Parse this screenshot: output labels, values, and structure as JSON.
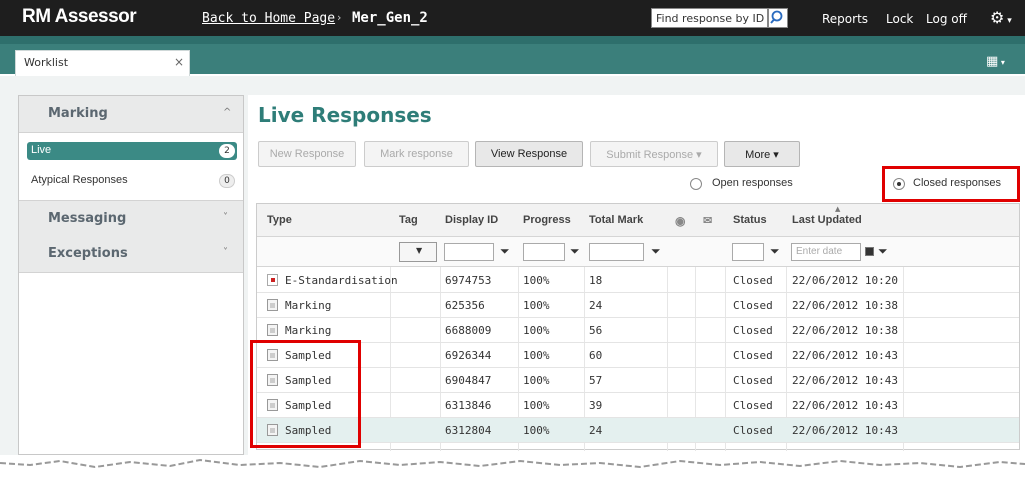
{
  "header": {
    "logo": "RM Assessor",
    "back_link": "Back to Home Page",
    "breadcrumb_sep": "›",
    "current": "Mer_Gen_2",
    "find_placeholder": "Find response by ID ▾",
    "reports": "Reports",
    "lock": "Lock",
    "logoff": "Log off"
  },
  "tab": {
    "label": "Worklist",
    "close": "×"
  },
  "sidebar": {
    "marking": {
      "label": "Marking",
      "chevron": "^"
    },
    "items": [
      {
        "label": "Live",
        "count": "2"
      },
      {
        "label": "Atypical Responses",
        "count": "0"
      }
    ],
    "messaging": {
      "label": "Messaging",
      "chevron": "˅"
    },
    "exceptions": {
      "label": "Exceptions",
      "chevron": "˅"
    }
  },
  "main": {
    "title": "Live Responses",
    "buttons": {
      "new_response": "New Response",
      "mark_response": "Mark response",
      "view_response": "View Response",
      "submit_response": "Submit Response ▾",
      "more": "More ▾"
    },
    "filters": {
      "open_label": "Open responses",
      "closed_label": "Closed responses",
      "selected": "closed"
    },
    "table": {
      "headers": {
        "type": "Type",
        "tag": "Tag",
        "display_id": "Display ID",
        "progress": "Progress",
        "total_mark": "Total Mark",
        "status": "Status",
        "last_updated": "Last Updated"
      },
      "date_placeholder": "Enter date",
      "rows": [
        {
          "type": "E-Standardisation",
          "icon": "estd",
          "display_id": "6974753",
          "progress": "100%",
          "total_mark": "18",
          "status": "Closed",
          "last_updated": "22/06/2012 10:20"
        },
        {
          "type": "Marking",
          "icon": "plain",
          "display_id": "625356",
          "progress": "100%",
          "total_mark": "24",
          "status": "Closed",
          "last_updated": "22/06/2012 10:38"
        },
        {
          "type": "Marking",
          "icon": "plain",
          "display_id": "6688009",
          "progress": "100%",
          "total_mark": "56",
          "status": "Closed",
          "last_updated": "22/06/2012 10:38"
        },
        {
          "type": "Sampled",
          "icon": "plain",
          "display_id": "6926344",
          "progress": "100%",
          "total_mark": "60",
          "status": "Closed",
          "last_updated": "22/06/2012 10:43"
        },
        {
          "type": "Sampled",
          "icon": "plain",
          "display_id": "6904847",
          "progress": "100%",
          "total_mark": "57",
          "status": "Closed",
          "last_updated": "22/06/2012 10:43"
        },
        {
          "type": "Sampled",
          "icon": "plain",
          "display_id": "6313846",
          "progress": "100%",
          "total_mark": "39",
          "status": "Closed",
          "last_updated": "22/06/2012 10:43"
        },
        {
          "type": "Sampled",
          "icon": "plain",
          "display_id": "6312804",
          "progress": "100%",
          "total_mark": "24",
          "status": "Closed",
          "last_updated": "22/06/2012 10:43"
        }
      ]
    }
  },
  "colors": {
    "header_bg": "#1e1e1e",
    "tab_strip": "#3b7f7b",
    "accent": "#2e7d78",
    "highlight_box": "#e00000"
  }
}
